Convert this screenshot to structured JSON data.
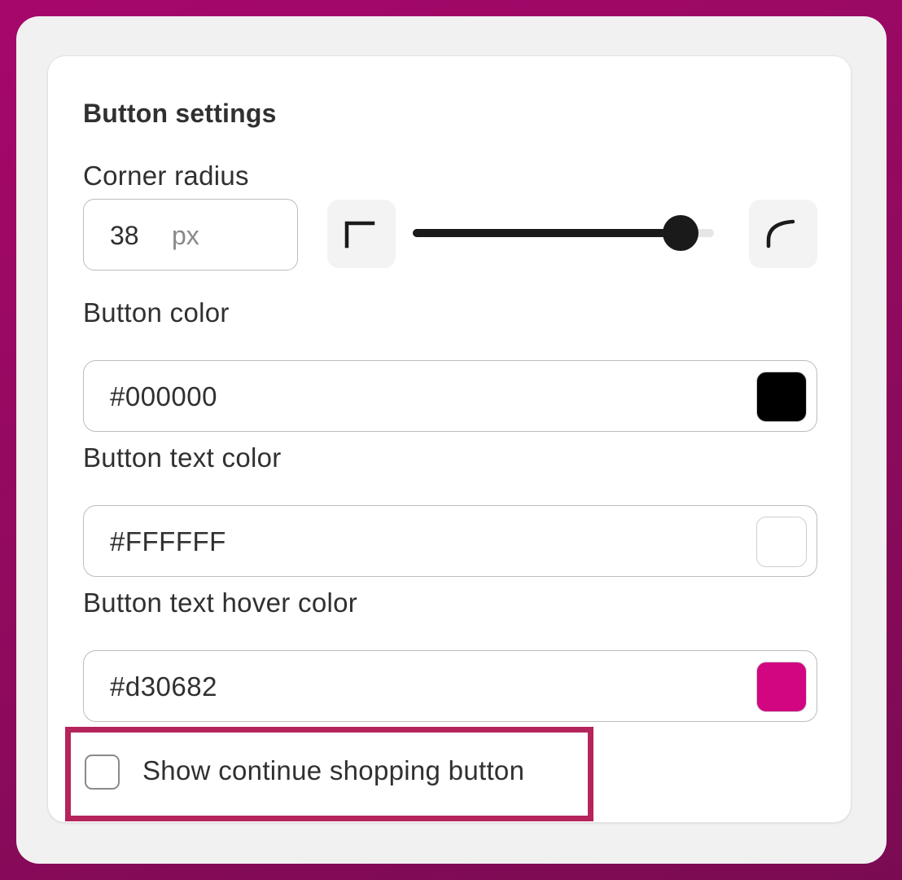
{
  "panel": {
    "title": "Button settings"
  },
  "corner_radius": {
    "label": "Corner radius",
    "value": "38",
    "unit": "px",
    "slider_fraction": 0.89,
    "square_corner_icon": "square-corner-icon",
    "rounded_corner_icon": "rounded-corner-icon"
  },
  "button_color": {
    "label": "Button color",
    "value": "#000000",
    "swatch": "#000000"
  },
  "button_text_color": {
    "label": "Button text color",
    "value": "#FFFFFF",
    "swatch": "#FFFFFF"
  },
  "button_text_hover_color": {
    "label": "Button text hover color",
    "value": "#d30682",
    "swatch": "#d30682"
  },
  "continue_shopping": {
    "label": "Show continue shopping button",
    "checked": false
  },
  "colors": {
    "background": "#a6086a",
    "highlight": "#b5245b",
    "slider": "#1a1a1a"
  }
}
